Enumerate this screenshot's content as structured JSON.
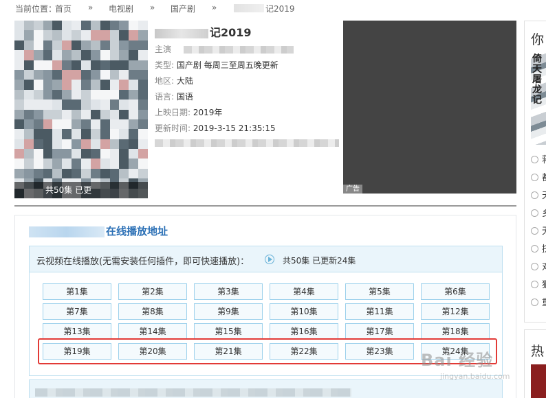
{
  "breadcrumb": {
    "prefix": "当前位置：",
    "home": "首页",
    "sep": "»",
    "level1": "电视剧",
    "level2": "国产剧",
    "current": "记2019"
  },
  "poster": {
    "caption": "共50集 已更"
  },
  "info": {
    "title": "记2019",
    "cast_key": "主演",
    "type_key": "类型:",
    "type_val": "国产剧  每周三至周五晚更新",
    "region_key": "地区:",
    "region_val": "大陆",
    "lang_key": "语言:",
    "lang_val": "国语",
    "date_key": "上映日期:",
    "date_val": "2019年",
    "update_key": "更新时间:",
    "update_val": "2019-3-15  21:35:15"
  },
  "ad": {
    "tag": "广告"
  },
  "right": {
    "header": "你",
    "header2": "热",
    "thumb_text": "倚天屠龙记",
    "items": [
      "蒋",
      "都",
      "天",
      "乡",
      "无",
      "挤",
      "对",
      "狠",
      "重"
    ]
  },
  "panel": {
    "title": "在线播放地址",
    "head_text": "云视频在线播放(无需安装任何插件，即可快速播放)：",
    "count": "共50集  已更新24集",
    "episodes": [
      "第1集",
      "第2集",
      "第3集",
      "第4集",
      "第5集",
      "第6集",
      "第7集",
      "第8集",
      "第9集",
      "第10集",
      "第11集",
      "第12集",
      "第13集",
      "第14集",
      "第15集",
      "第16集",
      "第17集",
      "第18集",
      "第19集",
      "第20集",
      "第21集",
      "第22集",
      "第23集",
      "第24集"
    ]
  },
  "watermark": {
    "brand": "Bai 经验",
    "url": "jingyan.baidu.com"
  },
  "colors": {
    "accent": "#2a6fb5",
    "highlight": "#e23a36",
    "episode_border": "#9dd1ec"
  }
}
